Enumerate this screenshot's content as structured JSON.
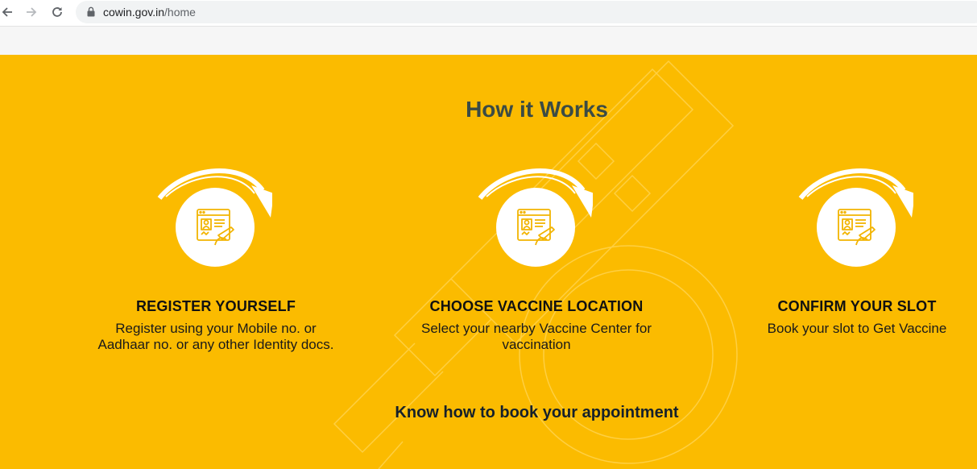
{
  "browser": {
    "url_domain": "cowin.gov.in",
    "url_path": "/home",
    "icons": [
      "back-icon",
      "forward-icon",
      "reload-icon",
      "lock-icon"
    ]
  },
  "section": {
    "title": "How it Works",
    "background_color": "#fbbb00",
    "title_color": "#3b4b45",
    "steps": [
      {
        "icon": "registration-form-icon",
        "title": "REGISTER YOURSELF",
        "description": "Register using your Mobile no. or Aadhaar no. or any other Identity docs."
      },
      {
        "icon": "registration-form-icon",
        "title": "CHOOSE VACCINE LOCATION",
        "description": "Select your nearby Vaccine Center for vaccination"
      },
      {
        "icon": "registration-form-icon",
        "title": "CONFIRM YOUR SLOT",
        "description": "Book your slot to Get Vaccine"
      }
    ],
    "cta_label": "Know how to book your appointment"
  }
}
